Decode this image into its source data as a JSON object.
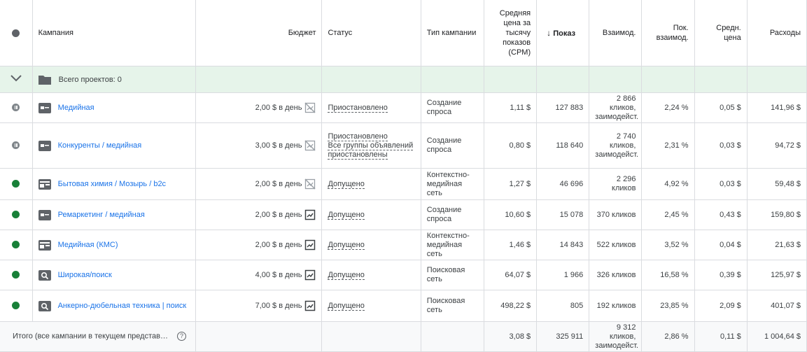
{
  "headers": {
    "campaign": "Кампания",
    "budget": "Бюджет",
    "status": "Статус",
    "type": "Тип кампании",
    "cpm": "Средняя цена за тысячу показов (CPM)",
    "impr": "Показ",
    "inter": "Взаимод.",
    "irate": "Пок. взаимод.",
    "avg": "Средн. цена",
    "cost": "Расходы"
  },
  "group": {
    "label": "Всего проектов: 0"
  },
  "rows": [
    {
      "name": "Медийная",
      "budget": "2,00 $ в день",
      "status1": "Приостановлено",
      "status2": "",
      "type": "Создание спроса",
      "cpm": "1,11 $",
      "impr": "127 883",
      "inter": "2 866 кликов, заимодейст.",
      "irate": "2,24 %",
      "avg": "0,05 $",
      "cost": "141,96 $"
    },
    {
      "name": "Конкуренты / медийная",
      "budget": "3,00 $ в день",
      "status1": "Приостановлено",
      "status2": "Все группы объявлений приостановлены",
      "type": "Создание спроса",
      "cpm": "0,80 $",
      "impr": "118 640",
      "inter": "2 740 кликов, заимодейст.",
      "irate": "2,31 %",
      "avg": "0,03 $",
      "cost": "94,72 $"
    },
    {
      "name": "Бытовая химия / Мозырь / b2c",
      "budget": "2,00 $ в день",
      "status1": "Допущено",
      "status2": "",
      "type": "Контекстно-медийная сеть",
      "cpm": "1,27 $",
      "impr": "46 696",
      "inter": "2 296 кликов",
      "irate": "4,92 %",
      "avg": "0,03 $",
      "cost": "59,48 $"
    },
    {
      "name": "Ремаркетинг / медийная",
      "budget": "2,00 $ в день",
      "status1": "Допущено",
      "status2": "",
      "type": "Создание спроса",
      "cpm": "10,60 $",
      "impr": "15 078",
      "inter": "370 кликов",
      "irate": "2,45 %",
      "avg": "0,43 $",
      "cost": "159,80 $"
    },
    {
      "name": "Медийная (КМС)",
      "budget": "2,00 $ в день",
      "status1": "Допущено",
      "status2": "",
      "type": "Контекстно-медийная сеть",
      "cpm": "1,46 $",
      "impr": "14 843",
      "inter": "522 кликов",
      "irate": "3,52 %",
      "avg": "0,04 $",
      "cost": "21,63 $"
    },
    {
      "name": "Широкая/поиск",
      "budget": "4,00 $ в день",
      "status1": "Допущено",
      "status2": "",
      "type": "Поисковая сеть",
      "cpm": "64,07 $",
      "impr": "1 966",
      "inter": "326 кликов",
      "irate": "16,58 %",
      "avg": "0,39 $",
      "cost": "125,97 $"
    },
    {
      "name": "Анкерно-дюбельная техника | поиск",
      "budget": "7,00 $ в день",
      "status1": "Допущено",
      "status2": "",
      "type": "Поисковая сеть",
      "cpm": "498,22 $",
      "impr": "805",
      "inter": "192 кликов",
      "irate": "23,85 %",
      "avg": "2,09 $",
      "cost": "401,07 $"
    }
  ],
  "total": {
    "label": "Итого (все кампании в текущем представ…",
    "help": "?",
    "cpm": "3,08 $",
    "impr": "325 911",
    "inter": "9 312 кликов, заимодейст.",
    "irate": "2,86 %",
    "avg": "0,11 $",
    "cost": "1 004,64 $"
  },
  "colors": {
    "accent": "#1a73e8",
    "enabled": "#188038",
    "group_bg": "#e6f4ea",
    "border": "#dadce0"
  },
  "icons": {
    "sort": "↓"
  }
}
